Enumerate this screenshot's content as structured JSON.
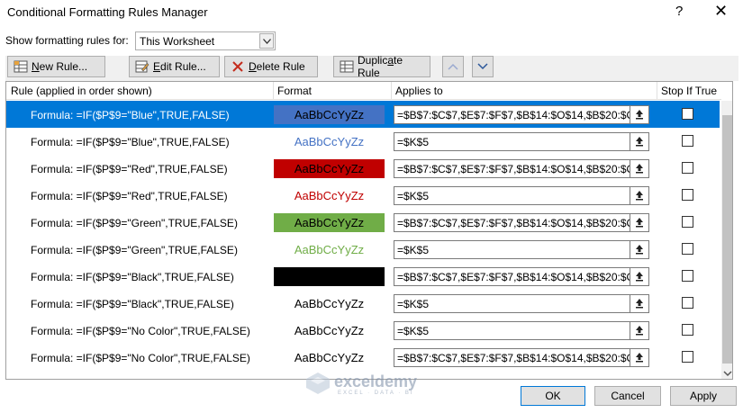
{
  "window": {
    "title": "Conditional Formatting Rules Manager",
    "help_glyph": "?",
    "close_glyph": "✕"
  },
  "scope": {
    "label": "Show formatting rules for:",
    "selected": "This Worksheet"
  },
  "toolbar": {
    "new_rule": "New Rule...",
    "edit_rule": "Edit Rule...",
    "delete_rule": "Delete Rule",
    "duplicate_rule": "Duplicate Rule"
  },
  "columns": {
    "rule": "Rule (applied in order shown)",
    "format": "Format",
    "applies_to": "Applies to",
    "stop_if_true": "Stop If True"
  },
  "rules": [
    {
      "rule": "Formula: =IF($P$9=\"Blue\",TRUE,FALSE)",
      "preview": "AaBbCcYyZz",
      "fill": "#4472c4",
      "text_color": "#000000",
      "applies": "=$B$7:$C$7,$E$7:$F$7,$B$14:$O$14,$B$20:$O$20,$"
    },
    {
      "rule": "Formula: =IF($P$9=\"Blue\",TRUE,FALSE)",
      "preview": "AaBbCcYyZz",
      "fill": "",
      "text_color": "#4472c4",
      "applies": "=$K$5"
    },
    {
      "rule": "Formula: =IF($P$9=\"Red\",TRUE,FALSE)",
      "preview": "AaBbCcYyZz",
      "fill": "#c00000",
      "text_color": "#000000",
      "applies": "=$B$7:$C$7,$E$7:$F$7,$B$14:$O$14,$B$20:$O$20,$"
    },
    {
      "rule": "Formula: =IF($P$9=\"Red\",TRUE,FALSE)",
      "preview": "AaBbCcYyZz",
      "fill": "",
      "text_color": "#c00000",
      "applies": "=$K$5"
    },
    {
      "rule": "Formula: =IF($P$9=\"Green\",TRUE,FALSE)",
      "preview": "AaBbCcYyZz",
      "fill": "#70ad47",
      "text_color": "#000000",
      "applies": "=$B$7:$C$7,$E$7:$F$7,$B$14:$O$14,$B$20:$O$20,$"
    },
    {
      "rule": "Formula: =IF($P$9=\"Green\",TRUE,FALSE)",
      "preview": "AaBbCcYyZz",
      "fill": "",
      "text_color": "#70ad47",
      "applies": "=$K$5"
    },
    {
      "rule": "Formula: =IF($P$9=\"Black\",TRUE,FALSE)",
      "preview": "AaBbCcYyZz",
      "fill": "#000000",
      "text_color": "#000000",
      "applies": "=$B$7:$C$7,$E$7:$F$7,$B$14:$O$14,$B$20:$O$20,$"
    },
    {
      "rule": "Formula: =IF($P$9=\"Black\",TRUE,FALSE)",
      "preview": "AaBbCcYyZz",
      "fill": "",
      "text_color": "#000000",
      "applies": "=$K$5"
    },
    {
      "rule": "Formula: =IF($P$9=\"No Color\",TRUE,FALSE)",
      "preview": "AaBbCcYyZz",
      "fill": "",
      "text_color": "#000000",
      "applies": "=$K$5"
    },
    {
      "rule": "Formula: =IF($P$9=\"No Color\",TRUE,FALSE)",
      "preview": "AaBbCcYyZz",
      "fill": "",
      "text_color": "#000000",
      "applies": "=$B$7:$C$7,$E$7:$F$7,$B$14:$O$14,$B$20:$O$20,$"
    }
  ],
  "footer": {
    "ok": "OK",
    "cancel": "Cancel",
    "apply": "Apply"
  },
  "watermark": {
    "brand": "exceldemy",
    "tagline": "EXCEL · DATA · BI"
  },
  "colors": {
    "selection": "#0078d7",
    "accent_blue": "#4472c4",
    "accent_red": "#c00000",
    "accent_green": "#70ad47"
  }
}
